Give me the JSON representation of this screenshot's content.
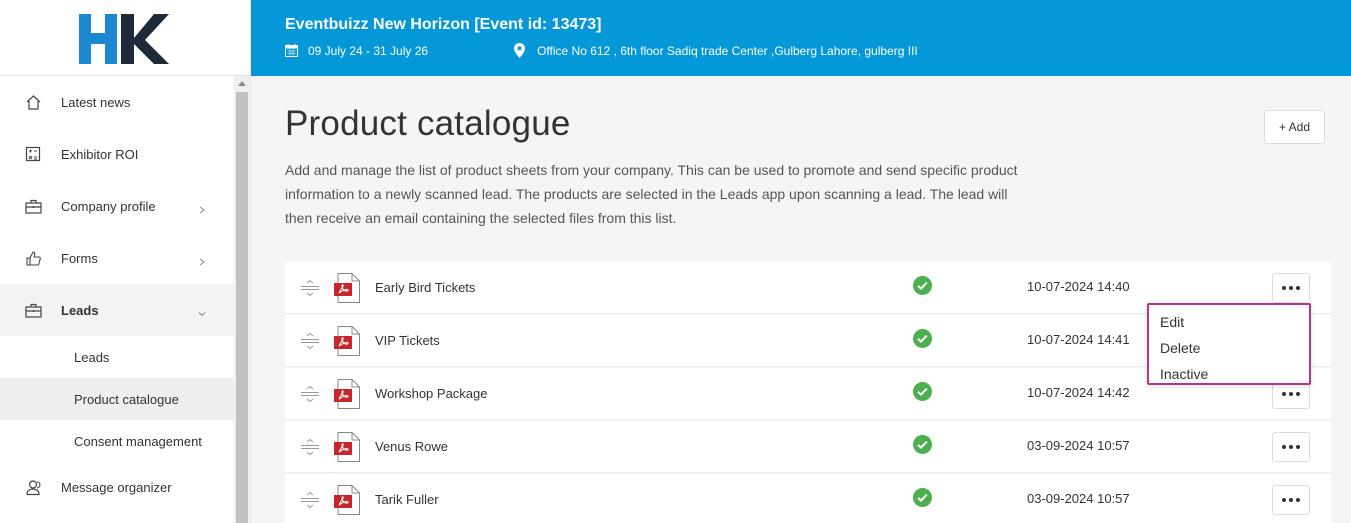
{
  "header": {
    "title": "Eventbuizz New Horizon [Event id: 13473]",
    "dates": "09 July 24 - 31 July 26",
    "location": "Office No 612 , 6th floor Sadiq trade Center ,Gulberg Lahore, gulberg III"
  },
  "sidebar": {
    "items": [
      {
        "label": "Latest news",
        "icon": "home-icon"
      },
      {
        "label": "Exhibitor ROI",
        "icon": "calculator-icon"
      },
      {
        "label": "Company profile",
        "icon": "briefcase-icon"
      },
      {
        "label": "Forms",
        "icon": "thumbs-up-icon"
      },
      {
        "label": "Leads",
        "icon": "briefcase-icon"
      }
    ],
    "sub_items": [
      {
        "label": "Leads"
      },
      {
        "label": "Product catalogue"
      },
      {
        "label": "Consent management"
      }
    ],
    "after": [
      {
        "label": "Message organizer",
        "icon": "users-icon"
      }
    ]
  },
  "main": {
    "title": "Product catalogue",
    "add_label": "+ Add",
    "description": "Add and manage the list of product sheets from your company. This can be used to promote and send specific product information to a newly scanned lead. The products are selected in the Leads app upon scanning a lead. The lead will then receive an email containing the selected files from this list.",
    "products": [
      {
        "name": "Early Bird Tickets",
        "date": "10-07-2024 14:40"
      },
      {
        "name": "VIP Tickets",
        "date": "10-07-2024 14:41"
      },
      {
        "name": "Workshop Package",
        "date": "10-07-2024 14:42"
      },
      {
        "name": "Venus Rowe",
        "date": "03-09-2024 10:57"
      },
      {
        "name": "Tarik Fuller",
        "date": "03-09-2024 10:57"
      }
    ]
  },
  "menu": {
    "edit": "Edit",
    "delete": "Delete",
    "inactive": "Inactive"
  },
  "colors": {
    "header_bg": "#0598d8",
    "active_check": "#4caf50",
    "menu_border": "#b8338a",
    "logo_blue": "#1b88d2",
    "logo_dark": "#1e2a3a"
  }
}
